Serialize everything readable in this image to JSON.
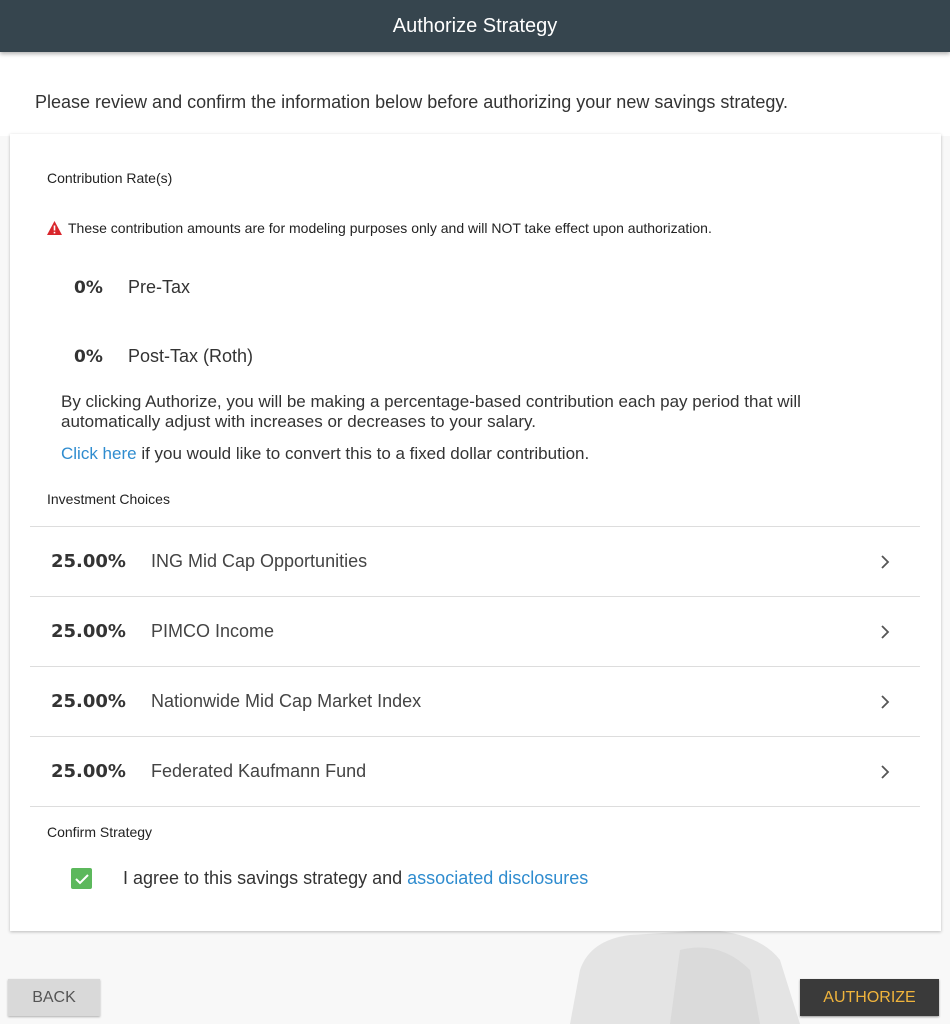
{
  "header": {
    "title": "Authorize Strategy"
  },
  "intro": "Please review and confirm the information below before authorizing your new savings strategy.",
  "contribution": {
    "section_label": "Contribution Rate(s)",
    "warning": "These contribution amounts are for modeling purposes only and will NOT take effect upon authorization.",
    "rates": [
      {
        "pct": "0%",
        "label": "Pre-Tax"
      },
      {
        "pct": "0%",
        "label": "Post-Tax (Roth)"
      }
    ],
    "explanation": "By clicking Authorize, you will be making a percentage-based contribution each pay period that will automatically adjust with increases or decreases to your salary.",
    "link_text": "Click here",
    "link_suffix": " if you would like to convert this to a fixed dollar contribution."
  },
  "investments": {
    "section_label": "Investment Choices",
    "items": [
      {
        "pct": "25.00%",
        "name": "ING Mid Cap Opportunities"
      },
      {
        "pct": "25.00%",
        "name": "PIMCO Income"
      },
      {
        "pct": "25.00%",
        "name": "Nationwide Mid Cap Market Index"
      },
      {
        "pct": "25.00%",
        "name": "Federated Kaufmann Fund"
      }
    ]
  },
  "confirm": {
    "section_label": "Confirm Strategy",
    "agree_text": "I agree to this savings strategy and ",
    "agree_link": "associated disclosures",
    "checked": true
  },
  "buttons": {
    "back": "BACK",
    "authorize": "AUTHORIZE"
  },
  "colors": {
    "header_bg": "#36454e",
    "link": "#2f8ccf",
    "checkbox": "#5cb85c",
    "warning": "#d9262c",
    "authorize_text": "#f0b43c",
    "authorize_bg": "#3a3a3a"
  }
}
